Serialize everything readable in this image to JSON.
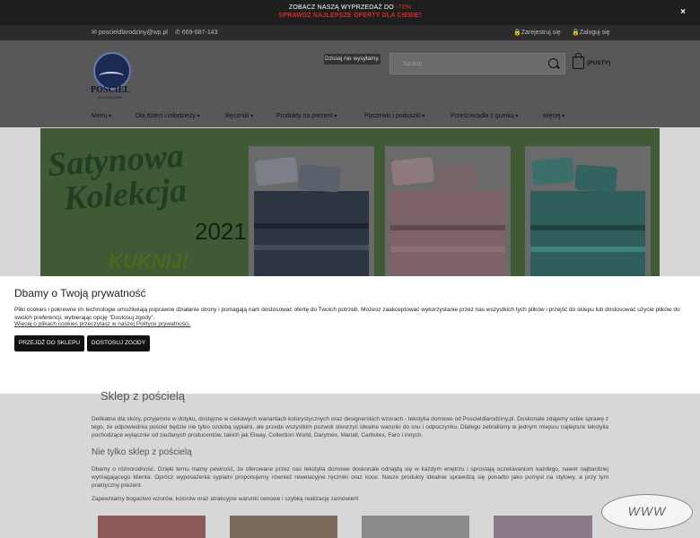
{
  "promo": {
    "line1_prefix": "ZOBACZ NASZĄ WYPRZEDAŻ DO ",
    "line1_highlight": "-70%",
    "line2": "SPRAWDŹ NAJLEPSZE OFERTY DLA CIEBIE!",
    "close_icon": "×"
  },
  "contact": {
    "email": "poscieldlarodziny@wp.pl",
    "phone": "669-687-143",
    "register": "Zarejestruj się",
    "login": "Zaloguj się"
  },
  "header": {
    "logo_name": "POŚCIEL",
    "logo_sub": "DLA RODZINY",
    "shipping_note": "Dzisiaj nie wysyłamy.",
    "search_placeholder": "Szukaj",
    "cart_label": "(PUSTY)"
  },
  "nav": {
    "items": [
      "Menu",
      "Dla dzieci i młodzieży",
      "Ręczniki",
      "Produkty na prezent",
      "Poszewki i poduszki",
      "Prześcieradła z gumką",
      "więcej"
    ]
  },
  "banner": {
    "title_line1": "Satynowa",
    "title_line2": "Kolekcja",
    "year": "2021",
    "cta": "KUKNIJ!"
  },
  "cookie": {
    "title": "Dbamy o Twoją prywatność",
    "body": "Pliki cookies i pokrewne im technologie umożliwiają poprawne działanie strony i pomagają nam dostosować ofertę do Twoich potrzeb. Możesz zaakceptować wykorzystanie przez nas wszystkich tych plików i przejść do sklepu lub dostosować użycie plików do swoich preferencji, wybierając opcję \"Dostosuj zgody\".",
    "more_link": "Więcej o plikach cookies przeczytasz w naszej Polityce prywatności.",
    "accept_button": "PRZEJDŹ DO SKLEPU",
    "customize_button": "DOSTOSUJ ZGODY"
  },
  "content": {
    "heading": "Sklep z pościelą",
    "paragraph1": "Delikatne dla skóry, przyjemne w dotyku, dostępne w ciekawych wariantach kolorystycznych oraz designerskich wzorach - tekstylia domowe od Poscieldlarodziny.pl. Doskonale zdajemy sobie sprawę z tego, że odpowiednia pościel będzie nie tylko ozdobą sypialni, ale przede wszystkim pozwoli stworzyć idealne warunki do snu i odpoczynku. Dlatego zebraliśmy w jednym miejscu najlepsze tekstylia pochodzące wyłącznie od zaufanych producentów, takich jak Elway, Collection World, Darymex, Mariall, Carbotex, Faro i innych.",
    "subheading": "Nie tylko sklep z pościelą",
    "paragraph2": "Dbamy o różnorodność. Dzięki temu mamy pewność, że oferowane przez nas tekstylia domowe doskonale odnajdą się w każdym wnętrzu i sprostają oczekiwaniom każdego, nawet najbardziej wymagającego klienta. Oprócz wyposażenia sypialni proponujemy również rewelacyjne ręczniki oraz koce. Nasze produkty idealnie sprawdzą się ponadto jako pomysł na stylowy, a przy tym praktyczny prezent.",
    "paragraph3": "Zapewniamy bogactwo wzorów, kolorów oraz atrakcyjne warunki cenowe i szybką realizację zamówień!"
  },
  "watermark": "WWW",
  "colors": {
    "promo_bg": "#1f1f1f",
    "promo_red": "#e4312a",
    "cookie_bg": "#ffffff",
    "button_bg": "#111111"
  }
}
